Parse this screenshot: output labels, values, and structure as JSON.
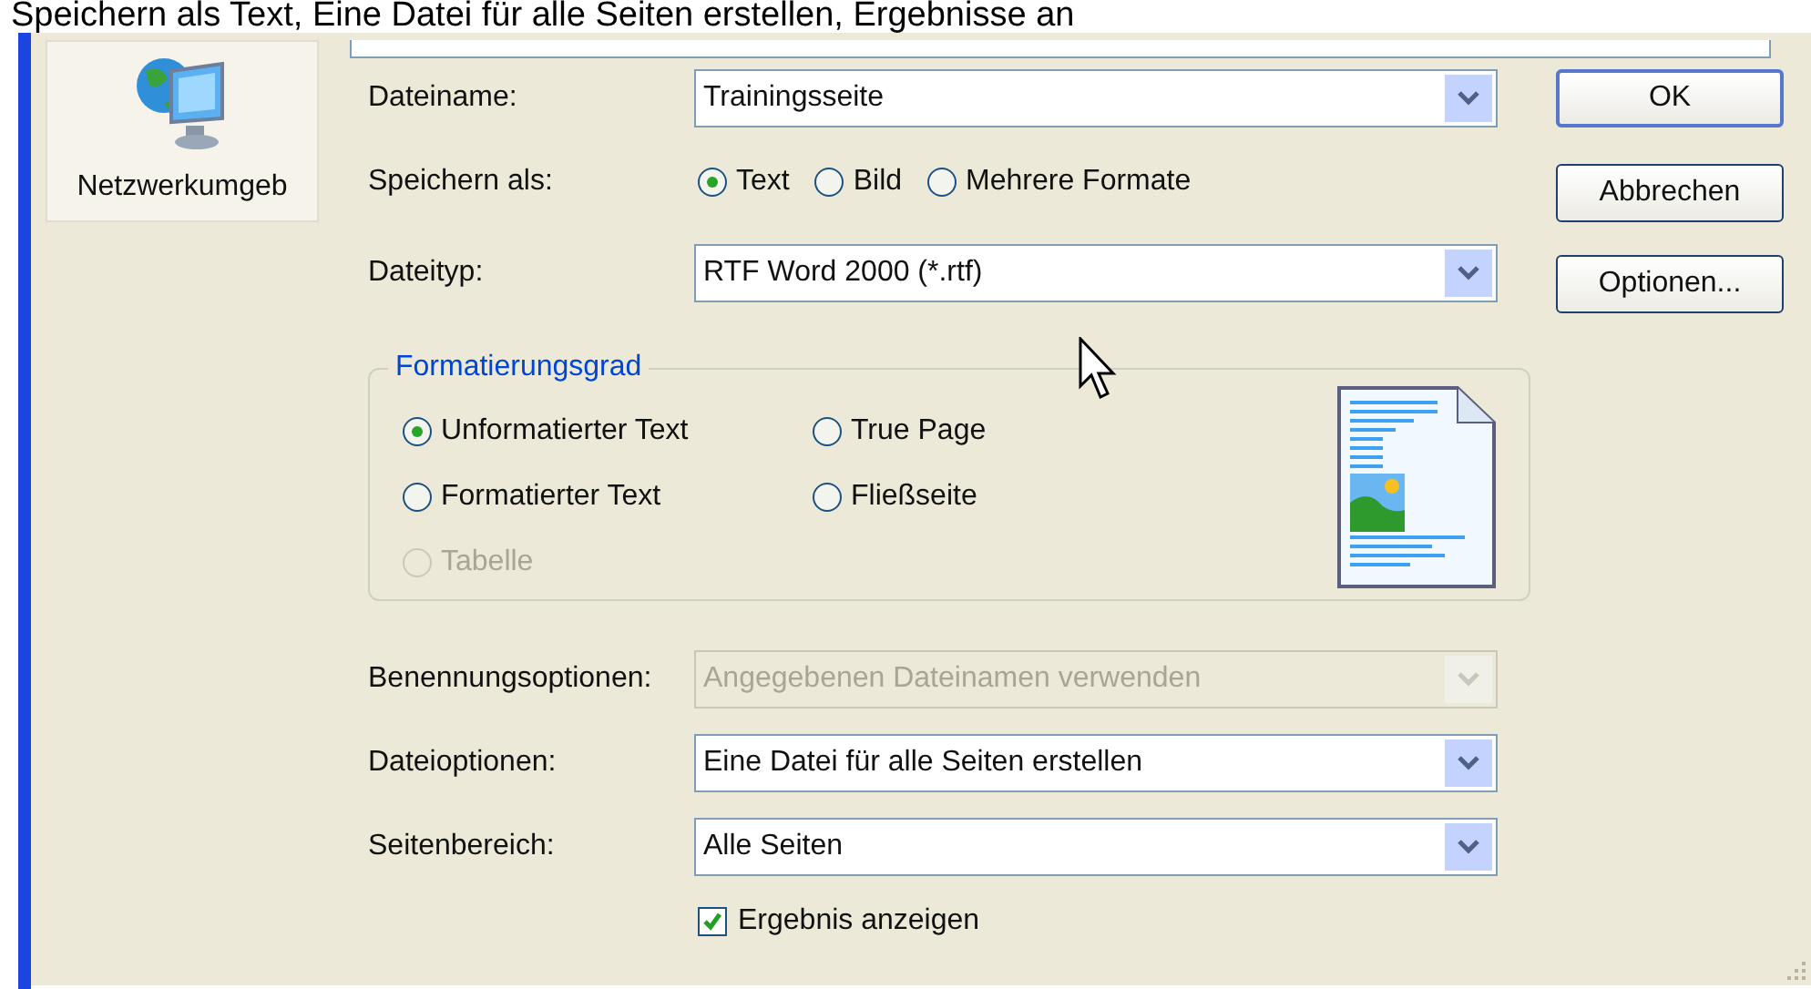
{
  "caption": "Speichern als Text, Eine Datei für alle Seiten erstellen, Ergebnisse an",
  "places_bar": [
    {
      "label": "Netzwerkumgeb",
      "selected": false
    }
  ],
  "filename": {
    "label": "Dateiname:",
    "value": "Trainingsseite"
  },
  "save_as": {
    "label": "Speichern als:",
    "options": [
      {
        "label": "Text",
        "selected": true
      },
      {
        "label": "Bild",
        "selected": false
      },
      {
        "label": "Mehrere Formate",
        "selected": false
      }
    ]
  },
  "file_type": {
    "label": "Dateityp:",
    "value": "RTF Word 2000 (*.rtf)"
  },
  "format_group": {
    "title": "Formatierungsgrad",
    "options": [
      {
        "label": "Unformatierter Text",
        "selected": true,
        "disabled": false
      },
      {
        "label": "True Page",
        "selected": false,
        "disabled": false
      },
      {
        "label": "Formatierter Text",
        "selected": false,
        "disabled": false
      },
      {
        "label": "Fließseite",
        "selected": false,
        "disabled": false
      },
      {
        "label": "Tabelle",
        "selected": false,
        "disabled": true
      }
    ]
  },
  "dropdowns": [
    {
      "label": "Benennungsoptionen:",
      "value": "Angegebenen Dateinamen verwenden",
      "disabled": true
    },
    {
      "label": "Dateioptionen:",
      "value": "Eine Datei für alle Seiten erstellen",
      "disabled": false
    },
    {
      "label": "Seitenbereich:",
      "value": "Alle Seiten",
      "disabled": false
    }
  ],
  "show_result": {
    "label": "Ergebnis anzeigen",
    "checked": true
  },
  "buttons": [
    {
      "label": "OK",
      "default": true
    },
    {
      "label": "Abbrechen",
      "default": false
    },
    {
      "label": "Optionen...",
      "default": false
    }
  ]
}
